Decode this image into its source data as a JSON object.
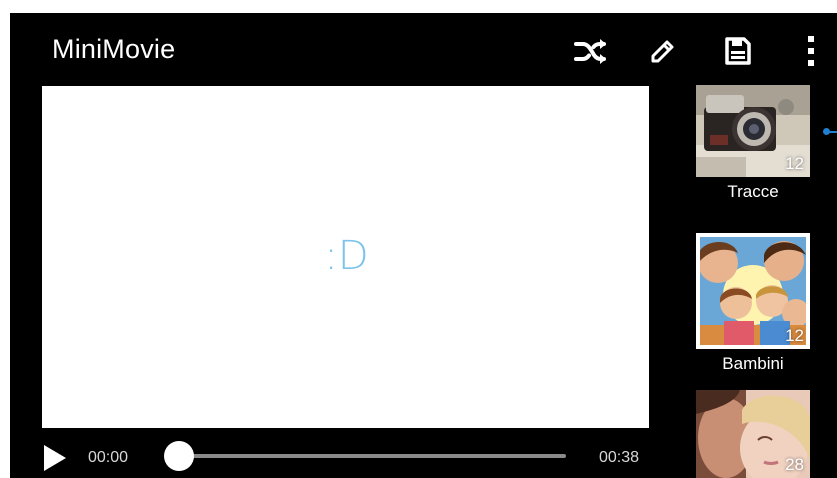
{
  "app": {
    "title": "MiniMovie"
  },
  "toolbar": {
    "actions": [
      {
        "icon": "shuffle-icon"
      },
      {
        "icon": "pencil-icon"
      },
      {
        "icon": "save-icon"
      },
      {
        "icon": "more-vert-icon"
      }
    ]
  },
  "preview": {
    "placeholder": ":D",
    "placeholder_color": "#7cc4ea"
  },
  "player": {
    "current_time": "00:00",
    "total_time": "00:38",
    "progress": 0.0
  },
  "albums": [
    {
      "label": "Tracce",
      "count": "12",
      "selected": false
    },
    {
      "label": "Bambini",
      "count": "12",
      "selected": true
    },
    {
      "label": "",
      "count": "28",
      "selected": false
    }
  ],
  "colors": {
    "background": "#000000",
    "accent": "#1f7fd0",
    "text": "#ffffff"
  }
}
